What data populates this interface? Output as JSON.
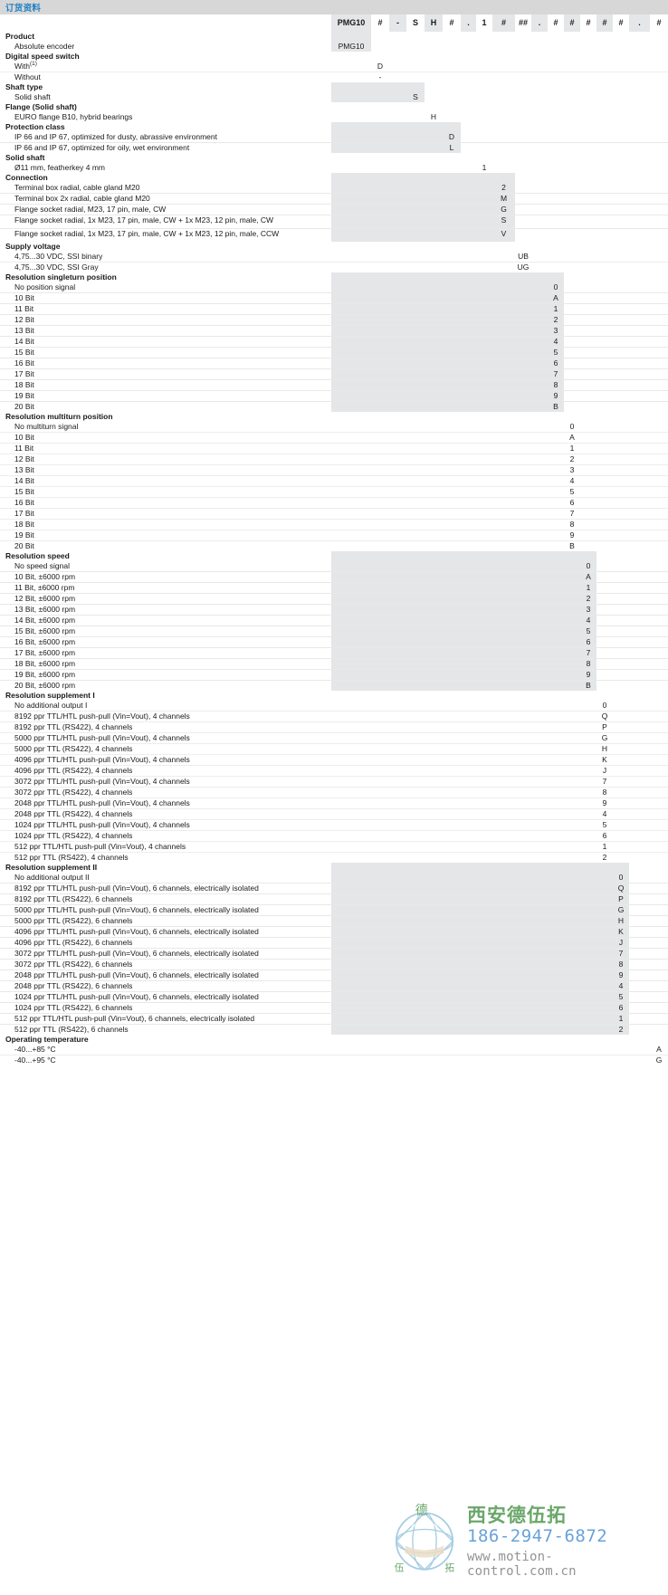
{
  "title": "订货资料",
  "colors": {
    "title_blue": "#1f7fc4",
    "titlebar_bg": "#d7d7d7",
    "row_shaded": "#e4e6e8",
    "row_white": "#ffffff",
    "watermark_green": "#5ea05e",
    "watermark_blue": "#5b9bd5",
    "watermark_gray": "#8a8a8a"
  },
  "header_codes": [
    "PMG10",
    "#",
    "-",
    "S",
    "H",
    "#",
    ".",
    "1",
    "#",
    "##",
    ".",
    "#",
    "#",
    "#",
    "#",
    "#",
    ".",
    "#"
  ],
  "watermark": {
    "company_cn": "西安德伍拓",
    "phone": "186-2947-6872",
    "website": "www.motion-control.com.cn",
    "logo_chars": [
      "德",
      "伍",
      "拓"
    ]
  },
  "sections": [
    {
      "group": "Product",
      "col": 0,
      "shade": "g",
      "rows": [
        {
          "label": "Absolute encoder",
          "code": "PMG10"
        }
      ]
    },
    {
      "group": "Digital speed switch",
      "col": 1,
      "shade": "w",
      "rows": [
        {
          "label": "With",
          "sup": "(1)",
          "code": "D"
        },
        {
          "label": "Without",
          "code": "-"
        }
      ]
    },
    {
      "group": "Shaft type",
      "col": 3,
      "shade": "g",
      "rows": [
        {
          "label": "Solid shaft",
          "code": "S"
        }
      ]
    },
    {
      "group": "Flange (Solid shaft)",
      "col": 4,
      "shade": "w",
      "rows": [
        {
          "label": "EURO flange B10, hybrid bearings",
          "code": "H"
        }
      ]
    },
    {
      "group": "Protection class",
      "col": 5,
      "shade": "g",
      "rows": [
        {
          "label": "IP 66 and IP 67, optimized for dusty, abrassive environment",
          "code": "D"
        },
        {
          "label": "IP 66 and IP 67, optimized for oily, wet environment",
          "code": "L"
        }
      ]
    },
    {
      "group": "Solid shaft",
      "col": 7,
      "shade": "w",
      "rows": [
        {
          "label": "Ø11 mm, featherkey 4 mm",
          "code": "1"
        }
      ]
    },
    {
      "group": "Connection",
      "col": 8,
      "shade": "g",
      "rows": [
        {
          "label": "Terminal box radial, cable gland M20",
          "code": "2"
        },
        {
          "label": "Terminal box 2x radial, cable gland M20",
          "code": "M"
        },
        {
          "label": "Flange socket radial, M23, 17 pin, male, CW",
          "code": "G"
        },
        {
          "label": "Flange socket radial, 1x M23, 17 pin, male, CW + 1x M23, 12 pin, male, CW",
          "code": "S",
          "tall": true
        },
        {
          "label": "Flange socket radial, 1x M23, 17 pin, male, CW + 1x M23, 12 pin, male, CCW",
          "code": "V",
          "tall": true
        }
      ]
    },
    {
      "group": "Supply voltage",
      "col": 9,
      "shade": "w",
      "rows": [
        {
          "label": "4,75...30 VDC, SSI binary",
          "code": "UB"
        },
        {
          "label": "4,75...30 VDC, SSI Gray",
          "code": "UG"
        }
      ]
    },
    {
      "group": "Resolution singleturn position",
      "col": 11,
      "shade": "g",
      "rows": [
        {
          "label": "No position signal",
          "code": "0"
        },
        {
          "label": "10 Bit",
          "code": "A"
        },
        {
          "label": "11 Bit",
          "code": "1"
        },
        {
          "label": "12 Bit",
          "code": "2"
        },
        {
          "label": "13 Bit",
          "code": "3"
        },
        {
          "label": "14 Bit",
          "code": "4"
        },
        {
          "label": "15 Bit",
          "code": "5"
        },
        {
          "label": "16 Bit",
          "code": "6"
        },
        {
          "label": "17 Bit",
          "code": "7"
        },
        {
          "label": "18 Bit",
          "code": "8"
        },
        {
          "label": "19 Bit",
          "code": "9"
        },
        {
          "label": "20 Bit",
          "code": "B"
        }
      ]
    },
    {
      "group": "Resolution multiturn position",
      "col": 12,
      "shade": "w",
      "rows": [
        {
          "label": "No multiturn signal",
          "code": "0"
        },
        {
          "label": "10 Bit",
          "code": "A"
        },
        {
          "label": "11 Bit",
          "code": "1"
        },
        {
          "label": "12 Bit",
          "code": "2"
        },
        {
          "label": "13 Bit",
          "code": "3"
        },
        {
          "label": "14 Bit",
          "code": "4"
        },
        {
          "label": "15 Bit",
          "code": "5"
        },
        {
          "label": "16 Bit",
          "code": "6"
        },
        {
          "label": "17 Bit",
          "code": "7"
        },
        {
          "label": "18 Bit",
          "code": "8"
        },
        {
          "label": "19 Bit",
          "code": "9"
        },
        {
          "label": "20 Bit",
          "code": "B"
        }
      ]
    },
    {
      "group": "Resolution speed",
      "col": 13,
      "shade": "g",
      "rows": [
        {
          "label": "No speed signal",
          "code": "0"
        },
        {
          "label": "10 Bit, ±6000 rpm",
          "code": "A"
        },
        {
          "label": "11 Bit, ±6000 rpm",
          "code": "1"
        },
        {
          "label": "12 Bit, ±6000 rpm",
          "code": "2"
        },
        {
          "label": "13 Bit, ±6000 rpm",
          "code": "3"
        },
        {
          "label": "14 Bit, ±6000 rpm",
          "code": "4"
        },
        {
          "label": "15 Bit, ±6000 rpm",
          "code": "5"
        },
        {
          "label": "16 Bit, ±6000 rpm",
          "code": "6"
        },
        {
          "label": "17 Bit, ±6000 rpm",
          "code": "7"
        },
        {
          "label": "18 Bit, ±6000 rpm",
          "code": "8"
        },
        {
          "label": "19 Bit, ±6000 rpm",
          "code": "9"
        },
        {
          "label": "20 Bit, ±6000 rpm",
          "code": "B"
        }
      ]
    },
    {
      "group": "Resolution supplement I",
      "col": 14,
      "shade": "w",
      "rows": [
        {
          "label": "No additional output I",
          "code": "0"
        },
        {
          "label": "8192 ppr TTL/HTL push-pull (Vin=Vout), 4 channels",
          "code": "Q"
        },
        {
          "label": "8192 ppr TTL (RS422), 4 channels",
          "code": "P"
        },
        {
          "label": "5000 ppr TTL/HTL push-pull (Vin=Vout), 4 channels",
          "code": "G"
        },
        {
          "label": "5000 ppr TTL (RS422), 4 channels",
          "code": "H"
        },
        {
          "label": "4096 ppr TTL/HTL push-pull (Vin=Vout), 4 channels",
          "code": "K"
        },
        {
          "label": "4096 ppr TTL (RS422), 4 channels",
          "code": "J"
        },
        {
          "label": "3072 ppr TTL/HTL push-pull (Vin=Vout), 4 channels",
          "code": "7"
        },
        {
          "label": "3072 ppr TTL (RS422), 4 channels",
          "code": "8"
        },
        {
          "label": "2048 ppr TTL/HTL push-pull (Vin=Vout), 4 channels",
          "code": "9"
        },
        {
          "label": "2048 ppr TTL (RS422), 4 channels",
          "code": "4"
        },
        {
          "label": "1024 ppr TTL/HTL push-pull (Vin=Vout), 4 channels",
          "code": "5"
        },
        {
          "label": "1024 ppr TTL (RS422), 4 channels",
          "code": "6"
        },
        {
          "label": "512 ppr TTL/HTL push-pull (Vin=Vout), 4 channels",
          "code": "1"
        },
        {
          "label": "512 ppr TTL (RS422), 4 channels",
          "code": "2"
        }
      ]
    },
    {
      "group": "Resolution supplement II",
      "col": 15,
      "shade": "g",
      "rows": [
        {
          "label": "No additional output II",
          "code": "0"
        },
        {
          "label": "8192 ppr TTL/HTL push-pull (Vin=Vout), 6 channels, electrically isolated",
          "code": "Q"
        },
        {
          "label": "8192 ppr TTL (RS422), 6 channels",
          "code": "P"
        },
        {
          "label": "5000 ppr TTL/HTL push-pull (Vin=Vout), 6 channels, electrically isolated",
          "code": "G"
        },
        {
          "label": "5000 ppr TTL (RS422), 6 channels",
          "code": "H"
        },
        {
          "label": "4096 ppr TTL/HTL push-pull (Vin=Vout), 6 channels, electrically isolated",
          "code": "K"
        },
        {
          "label": "4096 ppr TTL (RS422), 6 channels",
          "code": "J"
        },
        {
          "label": "3072 ppr TTL/HTL push-pull (Vin=Vout), 6 channels, electrically isolated",
          "code": "7"
        },
        {
          "label": "3072 ppr TTL (RS422), 6 channels",
          "code": "8"
        },
        {
          "label": "2048 ppr TTL/HTL push-pull (Vin=Vout), 6 channels, electrically isolated",
          "code": "9"
        },
        {
          "label": "2048 ppr TTL (RS422), 6 channels",
          "code": "4"
        },
        {
          "label": "1024 ppr TTL/HTL push-pull (Vin=Vout), 6 channels, electrically isolated",
          "code": "5"
        },
        {
          "label": "1024 ppr TTL (RS422), 6 channels",
          "code": "6"
        },
        {
          "label": "512 ppr TTL/HTL push-pull (Vin=Vout), 6 channels, electrically isolated",
          "code": "1"
        },
        {
          "label": "512 ppr TTL (RS422), 6 channels",
          "code": "2"
        }
      ]
    },
    {
      "group": "Operating temperature",
      "col": 17,
      "shade": "w",
      "rows": [
        {
          "label": "-40...+85 °C",
          "code": "A"
        },
        {
          "label": "-40...+95 °C",
          "code": "G"
        }
      ]
    }
  ]
}
